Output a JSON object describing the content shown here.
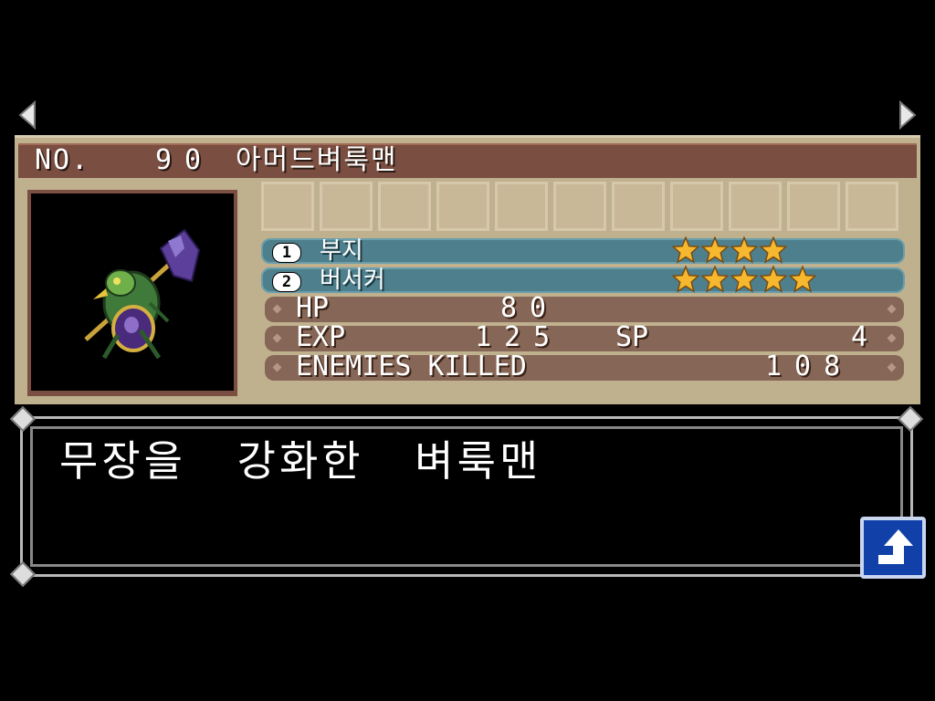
{
  "header": {
    "no_label": "NO.",
    "no_value": "90",
    "monster_name": "아머드벼룩맨"
  },
  "skills": [
    {
      "number": "1",
      "name": "부지",
      "stars": 4
    },
    {
      "number": "2",
      "name": "버서커",
      "stars": 5
    }
  ],
  "stats": {
    "hp_label": "HP",
    "hp_value": "80",
    "exp_label": "EXP",
    "exp_value": "125",
    "sp_label": "SP",
    "sp_value": "4",
    "kills_label": "ENEMIES KILLED",
    "kills_value": "108"
  },
  "description": "무장을 강화한 벼룩맨",
  "icons": {
    "nav_left": "left-arrow-icon",
    "nav_right": "right-arrow-icon",
    "back": "up-turn-arrow-icon",
    "star": "star-icon"
  },
  "colors": {
    "panel": "#bfb08e",
    "title_bar": "#7a4e40",
    "skill_row": "#4e7f8c",
    "stat_row": "#866656",
    "star": "#f5b82e",
    "back_button": "#1040a8"
  }
}
